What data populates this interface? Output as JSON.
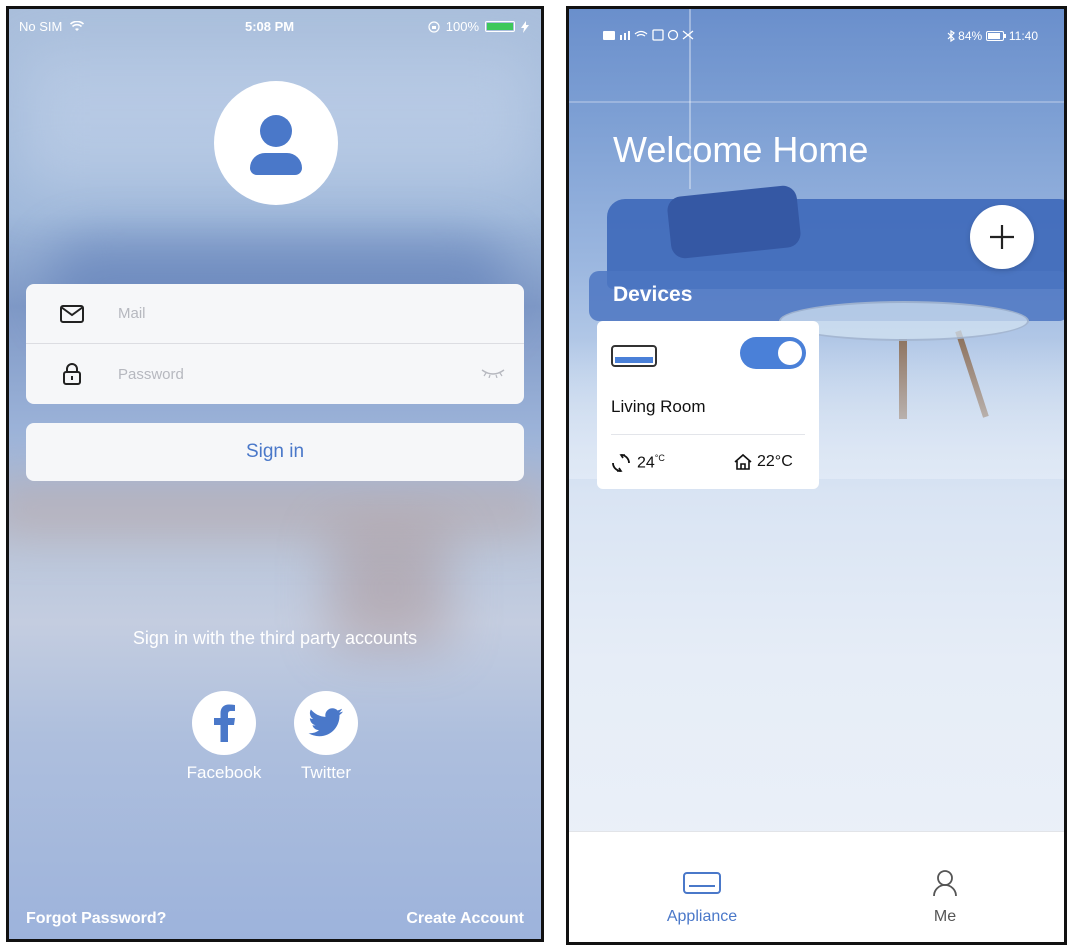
{
  "login_screen": {
    "status_bar": {
      "carrier": "No SIM",
      "time": "5:08 PM",
      "battery": "100%",
      "battery_level": 1.0
    },
    "mail_placeholder": "Mail",
    "password_placeholder": "Password",
    "sign_in_label": "Sign in",
    "third_party_text": "Sign in with the third party accounts",
    "social": [
      {
        "label": "Facebook",
        "icon": "facebook-icon"
      },
      {
        "label": "Twitter",
        "icon": "twitter-icon"
      }
    ],
    "forgot_password": "Forgot Password?",
    "create_account": "Create Account"
  },
  "home_screen": {
    "status_bar": {
      "battery": "84%",
      "time": "11:40"
    },
    "welcome_title": "Welcome Home",
    "add_icon": "plus-icon",
    "devices_title": "Devices",
    "devices": [
      {
        "name": "Living Room",
        "power_on": true,
        "set_temp": "24",
        "set_unit": "°C",
        "room_temp": "22°C"
      }
    ],
    "nav": [
      {
        "label": "Appliance",
        "icon": "air-conditioner-icon",
        "active": true
      },
      {
        "label": "Me",
        "icon": "person-icon",
        "active": false
      }
    ]
  },
  "colors": {
    "accent_blue": "#4a78c9",
    "toggle_blue": "#4a80d8",
    "battery_green": "#3ec85a"
  }
}
